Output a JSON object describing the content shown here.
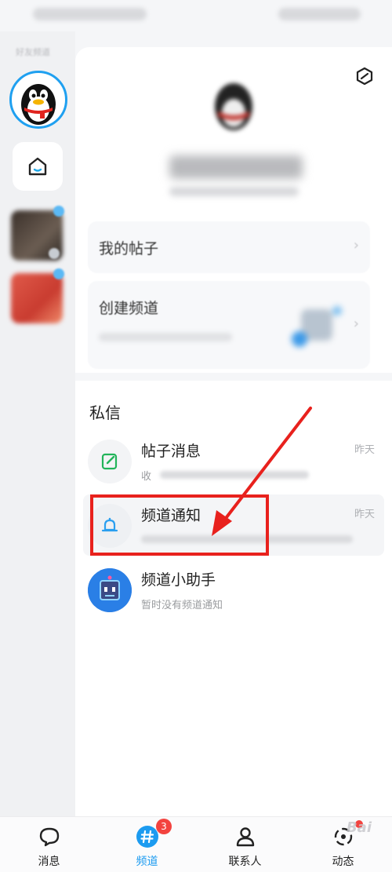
{
  "rail": {
    "label": "好友频道"
  },
  "panel": {
    "cards": {
      "my_posts": "我的帖子",
      "create_channel": "创建频道",
      "chevron": "›"
    },
    "dm_section_title": "私信",
    "dm_items": [
      {
        "title": "帖子消息",
        "time": "昨天",
        "preview": "收"
      },
      {
        "title": "频道通知",
        "time": "昨天",
        "preview": ""
      },
      {
        "title": "频道小助手",
        "time": "",
        "preview": "暂时没有频道通知"
      }
    ]
  },
  "tabbar": {
    "tabs": [
      {
        "label": "消息",
        "icon": "message-bubble-icon"
      },
      {
        "label": "频道",
        "icon": "channel-hash-icon",
        "badge": "3",
        "active": true
      },
      {
        "label": "联系人",
        "icon": "contacts-person-icon"
      },
      {
        "label": "动态",
        "icon": "feed-ring-icon",
        "dot": true
      }
    ]
  },
  "watermark": "Bai",
  "colors": {
    "accent": "#1c9bf0",
    "highlight": "#e8211d",
    "badge": "#f3433f",
    "post_icon": "#22b45a",
    "bell_icon": "#2a9ff0"
  }
}
